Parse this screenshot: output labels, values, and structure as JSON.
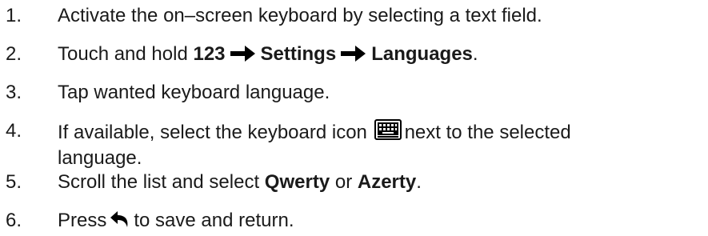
{
  "steps": [
    {
      "number": "1.",
      "text": "Activate the on–screen keyboard by selecting a text field."
    },
    {
      "number": "2.",
      "prefix": "Touch and hold ",
      "path": [
        "123",
        "Settings",
        "Languages"
      ],
      "suffix": ".",
      "arrow_icon": "right-arrow-icon"
    },
    {
      "number": "3.",
      "text": "Tap wanted keyboard language."
    },
    {
      "number": "4.",
      "line1_before": "If available, select the keyboard icon",
      "line1_after": "next to the selected",
      "line2": "language.",
      "icon": "keyboard-icon"
    },
    {
      "number": "5.",
      "prefix": "Scroll the list and select ",
      "option1": "Qwerty",
      "middle": " or ",
      "option2": "Azerty",
      "suffix": "."
    },
    {
      "number": "6.",
      "prefix": "Press",
      "icon": "back-arrow-icon",
      "suffix": "to save and return."
    }
  ]
}
